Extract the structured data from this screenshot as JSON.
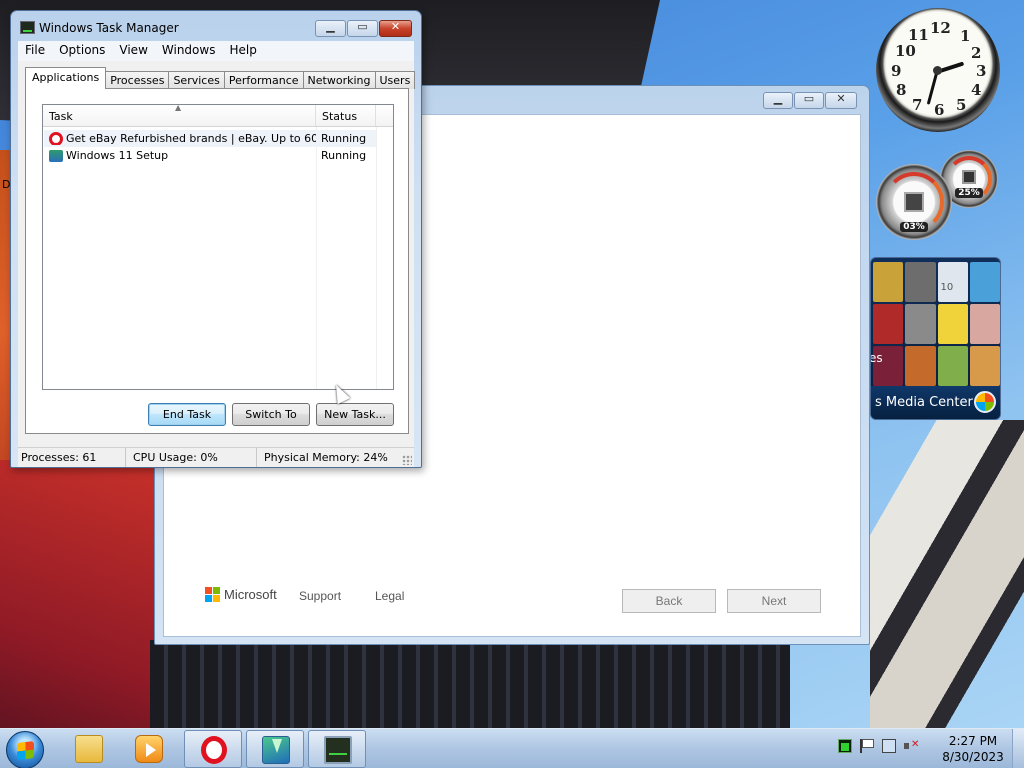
{
  "task_manager": {
    "title": "Windows Task Manager",
    "menu": [
      "File",
      "Options",
      "View",
      "Windows",
      "Help"
    ],
    "tabs": [
      "Applications",
      "Processes",
      "Services",
      "Performance",
      "Networking",
      "Users"
    ],
    "active_tab": "Applications",
    "columns": {
      "task": "Task",
      "status": "Status"
    },
    "tasks": [
      {
        "name": "Get eBay Refurbished brands | eBay. Up to 60...",
        "status": "Running",
        "icon": "opera-icon"
      },
      {
        "name": "Windows 11 Setup",
        "status": "Running",
        "icon": "setup-icon"
      }
    ],
    "buttons": {
      "end_task": "End Task",
      "switch_to": "Switch To",
      "new_task": "New Task..."
    },
    "status": {
      "processes": "Processes: 61",
      "cpu": "CPU Usage: 0%",
      "memory": "Physical Memory: 24%"
    }
  },
  "setup_window": {
    "brand": "Microsoft",
    "links": [
      "Support",
      "Legal"
    ],
    "back": "Back",
    "next": "Next"
  },
  "gadgets": {
    "clock_numbers": [
      "12",
      "1",
      "2",
      "3",
      "4",
      "5",
      "6",
      "7",
      "8",
      "9",
      "10",
      "11"
    ],
    "cpu_meter": "03%",
    "memory_meter": "25%",
    "media_center_label": "s Media Center",
    "media_center_fragment": "es",
    "tile_fragment": "10"
  },
  "desktop": {
    "stray_letter": "D"
  },
  "taskbar": {
    "time": "2:27 PM",
    "date": "8/30/2023",
    "pinned": [
      "folder-icon",
      "media-player-icon",
      "opera-icon",
      "windows-setup-icon",
      "task-manager-icon"
    ]
  },
  "colors": {
    "selection": "#eef3f9",
    "default_button": "#bee6fd",
    "opera_red": "#e0121f",
    "window_frame": "#b9d1ec"
  }
}
